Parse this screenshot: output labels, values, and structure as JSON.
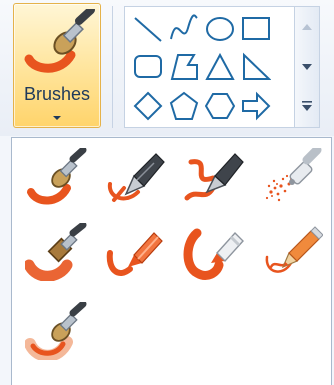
{
  "toolbar": {
    "brushes_label": "Brushes"
  },
  "shapes": [
    {
      "name": "line-shape"
    },
    {
      "name": "curve-shape"
    },
    {
      "name": "oval-shape"
    },
    {
      "name": "rectangle-shape"
    },
    {
      "name": "rounded-rectangle-shape"
    },
    {
      "name": "polygon-shape"
    },
    {
      "name": "triangle-shape"
    },
    {
      "name": "right-triangle-shape"
    },
    {
      "name": "diamond-shape"
    },
    {
      "name": "pentagon-shape"
    },
    {
      "name": "hexagon-shape"
    },
    {
      "name": "right-arrow-shape"
    }
  ],
  "brushes": [
    {
      "name": "brush-icon"
    },
    {
      "name": "calligraphy-brush-1-icon"
    },
    {
      "name": "calligraphy-brush-2-icon"
    },
    {
      "name": "airbrush-icon"
    },
    {
      "name": "oil-brush-icon"
    },
    {
      "name": "crayon-icon"
    },
    {
      "name": "marker-icon"
    },
    {
      "name": "natural-pencil-icon"
    },
    {
      "name": "watercolor-brush-icon"
    }
  ],
  "colors": {
    "accent_orange": "#e8541e",
    "highlight_fill": "#ffe49a",
    "highlight_border": "#e5b24a",
    "label_text": "#1e395b",
    "shape_stroke": "#1f6aa5"
  }
}
